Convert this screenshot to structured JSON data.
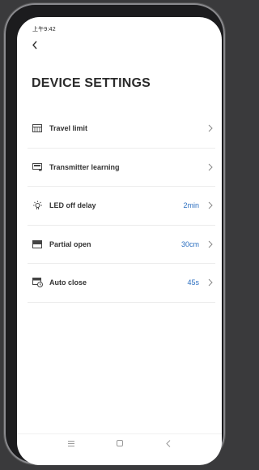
{
  "status_bar": {
    "time": "上午9:42"
  },
  "header": {
    "title": "DEVICE SETTINGS",
    "back_icon": "chevron-left-icon"
  },
  "settings": [
    {
      "icon": "travel-limit-icon",
      "label": "Travel limit",
      "value": ""
    },
    {
      "icon": "transmitter-icon",
      "label": "Transmitter learning",
      "value": ""
    },
    {
      "icon": "led-bulb-icon",
      "label": "LED off delay",
      "value": "2min"
    },
    {
      "icon": "partial-open-icon",
      "label": "Partial open",
      "value": "30cm"
    },
    {
      "icon": "auto-close-icon",
      "label": "Auto close",
      "value": "45s"
    }
  ],
  "nav_bar": {
    "icons": [
      "menu-icon",
      "home-icon",
      "back-icon"
    ]
  },
  "colors": {
    "accent": "#2c6fc0",
    "title": "#2b2b2b"
  }
}
